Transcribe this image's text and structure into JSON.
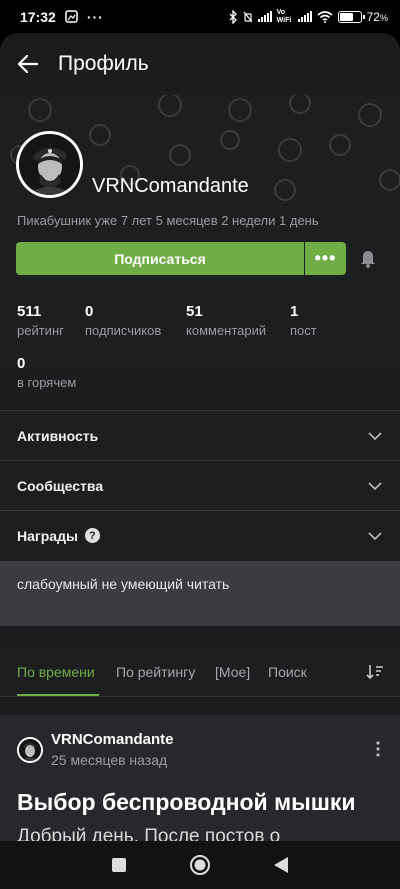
{
  "status_bar": {
    "time": "17:32",
    "battery": "72",
    "battery_level": 0.72,
    "wifi_label": "Vo WiFi"
  },
  "app_bar": {
    "title": "Профиль",
    "back_icon": "arrow-left-icon"
  },
  "profile": {
    "username": "VRNComandante",
    "member_since": "Пикабушник уже 7 лет 5 месяцев 2 недели 1 день",
    "subscribe_label": "Подписаться",
    "more_label": "•••"
  },
  "stats": [
    {
      "value": "511",
      "label": "рейтинг"
    },
    {
      "value": "0",
      "label": "подписчиков"
    },
    {
      "value": "51",
      "label": "комментарий"
    },
    {
      "value": "1",
      "label": "пост"
    },
    {
      "value": "0",
      "label": "в горячем"
    }
  ],
  "sections": [
    {
      "label": "Активность"
    },
    {
      "label": "Сообщества"
    },
    {
      "label": "Награды",
      "help": "?"
    }
  ],
  "about": "слабоумный не умеющий читать",
  "tabs": [
    {
      "label": "По времени",
      "active": true
    },
    {
      "label": "По рейтингу"
    },
    {
      "label": "[Мое]"
    },
    {
      "label": "Поиск"
    }
  ],
  "post": {
    "author": "VRNComandante",
    "time": "25 месяцев назад",
    "title": "Выбор беспроводной мышки",
    "text": "Добрый день. После постов о"
  },
  "colors": {
    "accent": "#70ad47",
    "background": "#1b1c1e",
    "about_bg": "#3a3c40"
  }
}
